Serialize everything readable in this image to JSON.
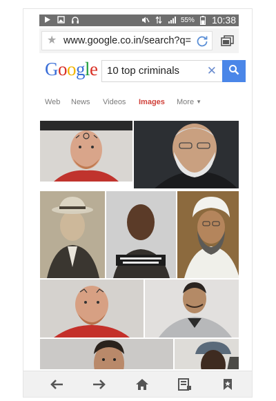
{
  "status_bar": {
    "battery": "55%",
    "time": "10:38"
  },
  "url_bar": {
    "url": "www.google.co.in/search?q="
  },
  "google": {
    "logo_letters": [
      {
        "char": "G",
        "color": "#3b6fd8"
      },
      {
        "char": "o",
        "color": "#d93025"
      },
      {
        "char": "o",
        "color": "#f2b400"
      },
      {
        "char": "g",
        "color": "#3b6fd8"
      },
      {
        "char": "l",
        "color": "#1f9e3d"
      },
      {
        "char": "e",
        "color": "#d93025"
      }
    ],
    "query": "10 top criminals"
  },
  "tabs": [
    {
      "label": "Web"
    },
    {
      "label": "News"
    },
    {
      "label": "Videos"
    },
    {
      "label": "Images",
      "active": true
    },
    {
      "label": "More"
    }
  ],
  "colors": {
    "accent": "#d0413a",
    "search_button": "#4a86e8"
  },
  "bottom_nav": [
    "back-icon",
    "forward-icon",
    "home-icon",
    "reading-list-icon",
    "bookmark-icon"
  ]
}
